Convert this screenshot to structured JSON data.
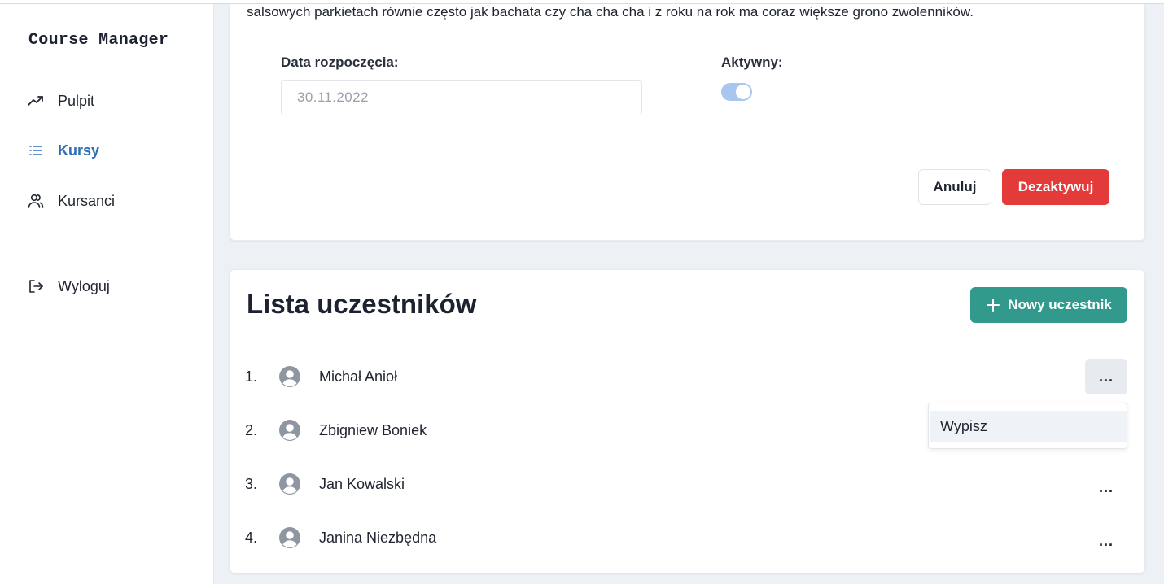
{
  "app": {
    "title": "Course Manager"
  },
  "sidebar": {
    "items": [
      {
        "label": "Pulpit",
        "icon": "trending-up-icon",
        "active": false
      },
      {
        "label": "Kursy",
        "icon": "list-icon",
        "active": true
      },
      {
        "label": "Kursanci",
        "icon": "users-icon",
        "active": false
      }
    ],
    "logout": {
      "label": "Wyloguj",
      "icon": "logout-icon"
    }
  },
  "course": {
    "description": "salsowych parkietach równie często jak bachata czy cha cha cha i z roku na rok ma coraz większe grono zwolenników.",
    "start_date_label": "Data rozpoczęcia:",
    "start_date_value": "30.11.2022",
    "active_label": "Aktywny:",
    "active": true,
    "cancel_label": "Anuluj",
    "deactivate_label": "Dezaktywuj"
  },
  "participants": {
    "title": "Lista uczestników",
    "new_button_label": "Nowy uczestnik",
    "more_label": "...",
    "rows": [
      {
        "num": "1.",
        "name": "Michał Anioł"
      },
      {
        "num": "2.",
        "name": "Zbigniew Boniek"
      },
      {
        "num": "3.",
        "name": "Jan Kowalski"
      },
      {
        "num": "4.",
        "name": "Janina Niezbędna"
      }
    ],
    "dropdown": {
      "item_label": "Wypisz"
    }
  },
  "colors": {
    "accent_blue": "#2f6db5",
    "danger": "#e33a3a",
    "teal": "#319a8d",
    "toggle_on": "#a9c6ef"
  }
}
